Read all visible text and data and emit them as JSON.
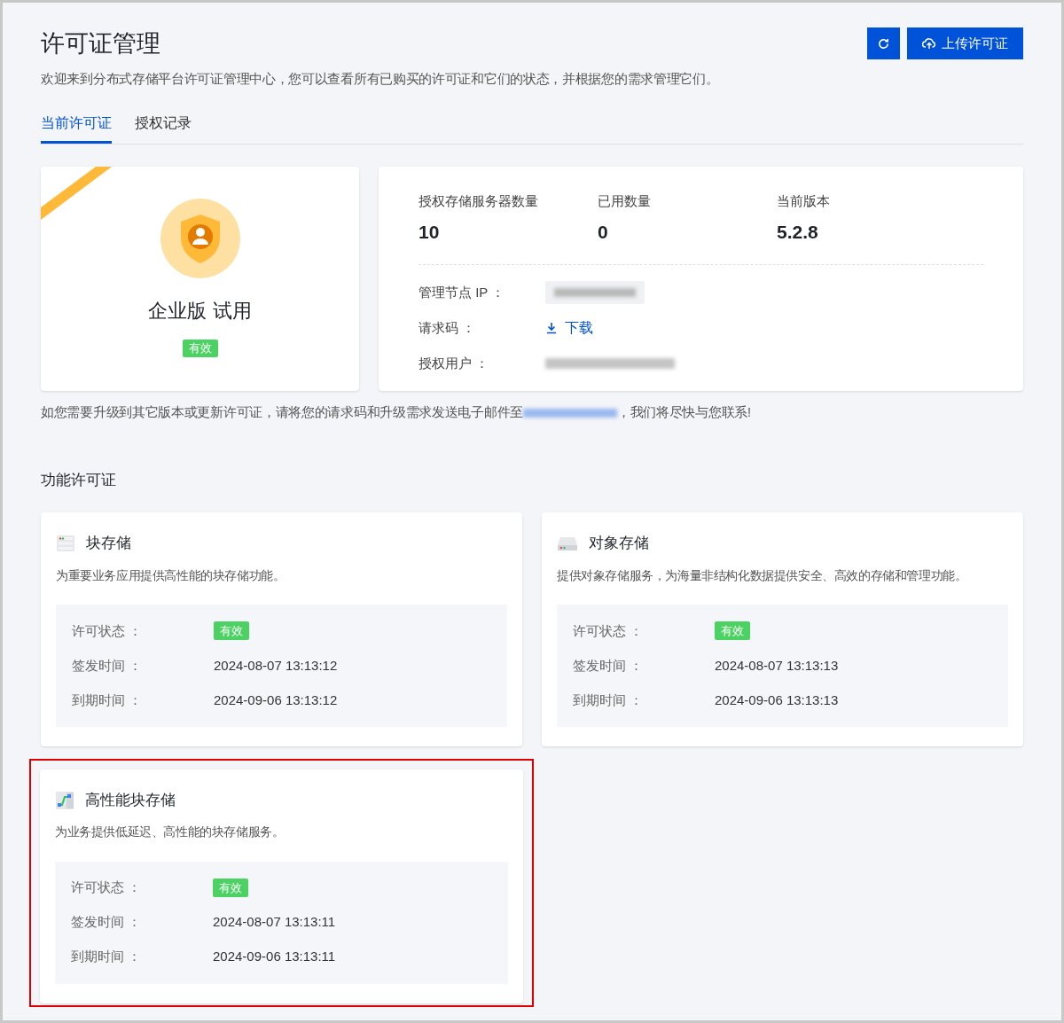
{
  "header": {
    "title": "许可证管理",
    "description": "欢迎来到分布式存储平台许可证管理中心，您可以查看所有已购买的许可证和它们的状态，并根据您的需求管理它们。",
    "upload_button": "上传许可证"
  },
  "tabs": [
    {
      "label": "当前许可证",
      "selected": true
    },
    {
      "label": "授权记录",
      "selected": false
    }
  ],
  "license_card": {
    "edition": "企业版 试用",
    "status": "有效"
  },
  "summary": {
    "stats": [
      {
        "label": "授权存储服务器数量",
        "value": "10"
      },
      {
        "label": "已用数量",
        "value": "0"
      },
      {
        "label": "当前版本",
        "value": "5.2.8"
      }
    ],
    "details": [
      {
        "kind": "redacted",
        "label": "管理节点 IP ："
      },
      {
        "kind": "link",
        "label": "请求码 ：",
        "value": "下载"
      },
      {
        "kind": "blurred",
        "label": "授权用户 ："
      }
    ]
  },
  "notice": {
    "before": "如您需要升级到其它版本或更新许可证，请将您的请求码和升级需求发送电子邮件至",
    "after": "，我们将尽快与您联系!"
  },
  "features": {
    "title": "功能许可证",
    "items": [
      {
        "kind": "block",
        "name": "块存储",
        "description": "为重要业务应用提供高性能的块存储功能。",
        "highlighted": false,
        "rows": [
          {
            "label": "许可状态 ：",
            "value": "有效",
            "kind": "badge"
          },
          {
            "label": "签发时间 ：",
            "value": "2024-08-07 13:13:12",
            "kind": "text"
          },
          {
            "label": "到期时间 ：",
            "value": "2024-09-06 13:13:12",
            "kind": "text"
          }
        ]
      },
      {
        "kind": "object",
        "name": "对象存储",
        "description": "提供对象存储服务，为海量非结构化数据提供安全、高效的存储和管理功能。",
        "highlighted": false,
        "rows": [
          {
            "label": "许可状态 ：",
            "value": "有效",
            "kind": "badge"
          },
          {
            "label": "签发时间 ：",
            "value": "2024-08-07 13:13:13",
            "kind": "text"
          },
          {
            "label": "到期时间 ：",
            "value": "2024-09-06 13:13:13",
            "kind": "text"
          }
        ]
      },
      {
        "kind": "fast",
        "name": "高性能块存储",
        "description": "为业务提供低延迟、高性能的块存储服务。",
        "highlighted": true,
        "rows": [
          {
            "label": "许可状态 ：",
            "value": "有效",
            "kind": "badge"
          },
          {
            "label": "签发时间 ：",
            "value": "2024-08-07 13:13:11",
            "kind": "text"
          },
          {
            "label": "到期时间 ：",
            "value": "2024-09-06 13:13:11",
            "kind": "text"
          }
        ]
      }
    ]
  }
}
